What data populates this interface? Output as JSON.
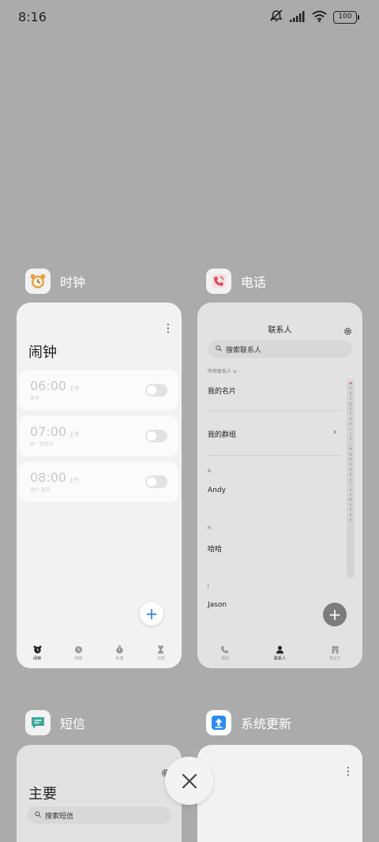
{
  "status_bar": {
    "time": "8:16",
    "battery": "100",
    "icons": [
      "mute-icon",
      "signal-icon",
      "wifi-icon",
      "battery-icon"
    ]
  },
  "apps": {
    "clock": {
      "name": "时钟",
      "title": "闹钟",
      "alarms": [
        {
          "time": "06:00",
          "ampm": "上午",
          "repeat": "每天",
          "enabled": false
        },
        {
          "time": "07:00",
          "ampm": "上午",
          "repeat": "周一至周五",
          "enabled": false
        },
        {
          "time": "08:00",
          "ampm": "上午",
          "repeat": "周六 周日",
          "enabled": false
        }
      ],
      "nav": [
        "闹钟",
        "时钟",
        "秒表",
        "计时"
      ]
    },
    "phone": {
      "name": "电话",
      "title": "联系人",
      "search_placeholder": "搜索联系人",
      "all_contacts": "所有联系人",
      "my_card": "我的名片",
      "my_groups": "我的群组",
      "sections": [
        {
          "letter": "A",
          "name": "Andy"
        },
        {
          "letter": "H",
          "name": "哈哈"
        },
        {
          "letter": "J",
          "name": "Jason"
        }
      ],
      "index_letters": [
        "♥",
        "A",
        "B",
        "C",
        "D",
        "E",
        "F",
        "G",
        "H",
        "I",
        "J",
        "K",
        "L",
        "M",
        "N",
        "O",
        "P",
        "Q",
        "R",
        "S",
        "T",
        "U",
        "V",
        "W",
        "X",
        "Y",
        "Z",
        "#"
      ],
      "nav": [
        "通话",
        "联系人",
        "营业厅"
      ]
    },
    "sms": {
      "name": "短信",
      "title": "主要",
      "search_placeholder": "搜索短信"
    },
    "updater": {
      "name": "系统更新"
    }
  },
  "colors": {
    "background": "#ababab",
    "card": "#f2f2f2",
    "accent_blue": "#2b7be4",
    "updater_blue": "#2a8cf0"
  }
}
